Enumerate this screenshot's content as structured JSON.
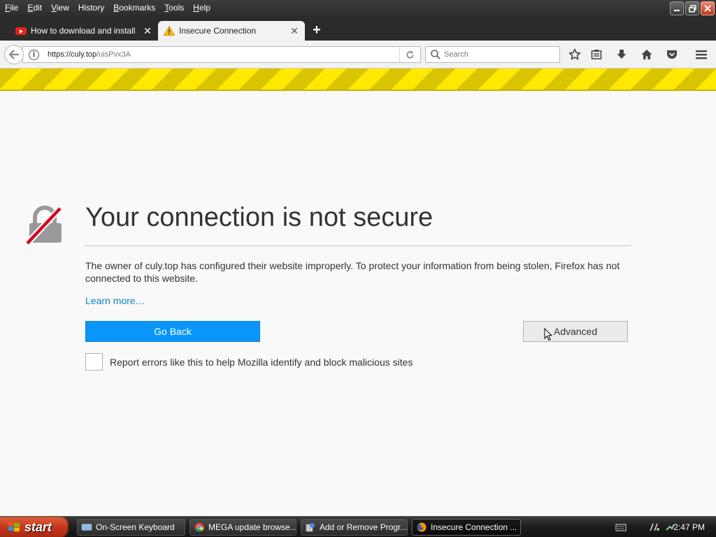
{
  "menubar": {
    "items": [
      {
        "first": "F",
        "rest": "ile"
      },
      {
        "first": "E",
        "rest": "dit"
      },
      {
        "first": "V",
        "rest": "iew"
      },
      {
        "first": "",
        "rest": "History",
        "underline_index": 0
      },
      {
        "first": "B",
        "rest": "ookmarks"
      },
      {
        "first": "T",
        "rest": "ools"
      },
      {
        "first": "H",
        "rest": "elp"
      }
    ]
  },
  "tabs": [
    {
      "label": "How to download and install ...",
      "icon": "youtube-icon",
      "active": false
    },
    {
      "label": "Insecure Connection",
      "icon": "warning-icon",
      "active": true
    }
  ],
  "new_tab_label": "+",
  "navbar": {
    "url_host": "https://culy.top",
    "url_path": "/uisPvx3A",
    "search_placeholder": "Search"
  },
  "page": {
    "title": "Your connection is not secure",
    "description": "The owner of culy.top has configured their website improperly. To protect your information from being stolen, Firefox has not connected to this website.",
    "learn_more": "Learn more…",
    "go_back": "Go Back",
    "advanced": "Advanced",
    "report_label": "Report errors like this to help Mozilla identify and block malicious sites",
    "report_checked": false
  },
  "taskbar": {
    "start_label": "start",
    "tasks": [
      {
        "label": "On-Screen Keyboard",
        "icon": "keyboard-icon",
        "active": false
      },
      {
        "label": "MEGA update browse...",
        "icon": "chrome-icon",
        "active": false
      },
      {
        "label": "Add or Remove Progr...",
        "icon": "programs-icon",
        "active": false
      },
      {
        "label": "Insecure Connection ...",
        "icon": "firefox-icon",
        "active": true
      }
    ],
    "clock": "2:47 PM"
  },
  "colors": {
    "accent_blue": "#0996f8",
    "link_blue": "#0a84c4",
    "warning_stripe": "#ffe900",
    "lock_slash": "#d70022"
  }
}
